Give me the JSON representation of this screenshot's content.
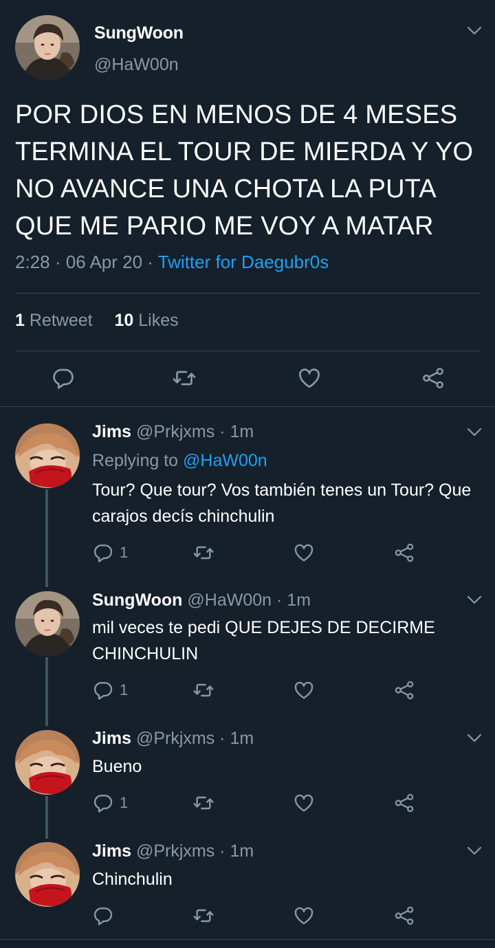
{
  "main_tweet": {
    "name": "SungWoon",
    "handle": "@HaW00n",
    "text": "POR DIOS EN MENOS DE 4 MESES TERMINA EL TOUR DE MIERDA Y YO NO AVANCE UNA CHOTA LA PUTA QUE ME PARIO ME VOY A MATAR",
    "time": "2:28",
    "date": "06 Apr 20",
    "source": "Twitter for Daegubr0s",
    "retweet_count": "1",
    "retweet_label": "Retweet",
    "like_count": "10",
    "like_label": "Likes"
  },
  "replies": [
    {
      "name": "Jims",
      "handle": "@Prkjxms",
      "time": "1m",
      "replying_prefix": "Replying to",
      "replying_to": "@HaW00n",
      "text": "Tour? Que tour? Vos también tenes un Tour? Que carajos decís chinchulin",
      "reply_count": "1"
    },
    {
      "name": "SungWoon",
      "handle": "@HaW00n",
      "time": "1m",
      "text": "mil veces te pedi QUE DEJES DE DECIRME CHINCHULIN",
      "reply_count": "1"
    },
    {
      "name": "Jims",
      "handle": "@Prkjxms",
      "time": "1m",
      "text": "Bueno",
      "reply_count": "1"
    },
    {
      "name": "Jims",
      "handle": "@Prkjxms",
      "time": "1m",
      "text": "Chinchulin",
      "reply_count": ""
    }
  ],
  "icons": {
    "reply": "reply-icon",
    "retweet": "retweet-icon",
    "like": "like-icon",
    "share": "share-icon",
    "menu": "chevron-down-icon"
  },
  "colors": {
    "background": "#15202b",
    "secondary_text": "#8899a6",
    "link": "#1da1f2",
    "divider": "#38444d",
    "thread_line": "#3d5466"
  }
}
